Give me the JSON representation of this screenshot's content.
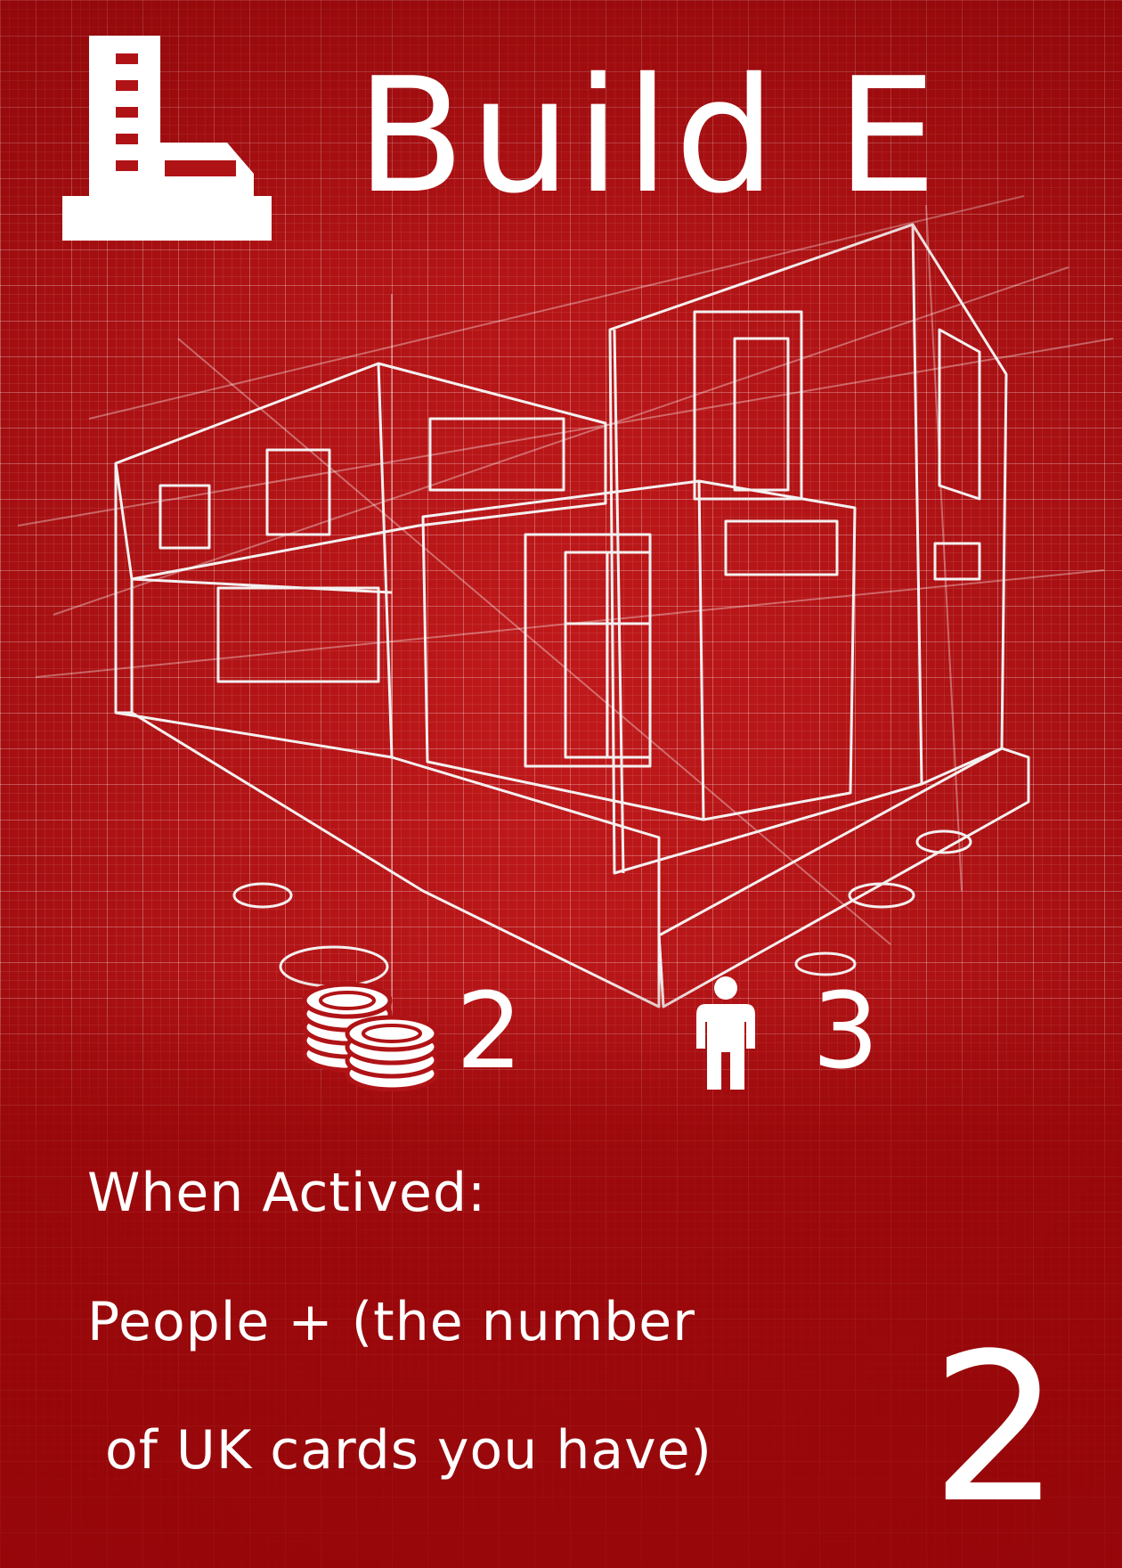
{
  "card": {
    "title": "Build E",
    "type_icon": "building-icon",
    "theme_color": "#b01316",
    "stats": {
      "coins_icon": "coin-stack-icon",
      "coins_value": "2",
      "people_icon": "person-icon",
      "people_value": "3"
    },
    "effect": {
      "heading": "When Actived:",
      "line_1": "People + (the number",
      "line_2": " of UK cards you have)"
    },
    "corner_number": "2"
  }
}
